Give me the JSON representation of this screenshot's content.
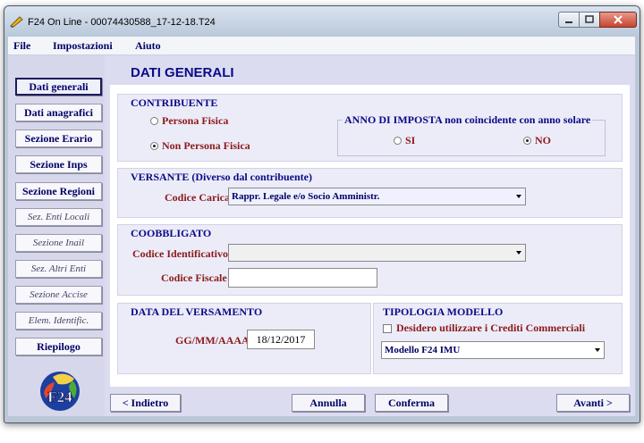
{
  "window": {
    "title": "F24 On Line - 00074430588_17-12-18.T24"
  },
  "menu": [
    "File",
    "Impostazioni",
    "Aiuto"
  ],
  "sidebar": {
    "items": [
      {
        "label": "Dati generali"
      },
      {
        "label": "Dati anagrafici"
      },
      {
        "label": "Sezione Erario"
      },
      {
        "label": "Sezione Inps"
      },
      {
        "label": "Sezione Regioni"
      },
      {
        "label": "Sez. Enti Locali"
      },
      {
        "label": "Sezione Inail"
      },
      {
        "label": "Sez. Altri Enti"
      },
      {
        "label": "Sezione Accise"
      },
      {
        "label": "Elem. Identific."
      },
      {
        "label": "Riepilogo"
      }
    ],
    "logo_text": "F24"
  },
  "page": {
    "title": "DATI GENERALI"
  },
  "contribuente": {
    "title": "CONTRIBUENTE",
    "persona_fisica": "Persona Fisica",
    "non_persona_fisica": "Non Persona Fisica",
    "anno_title": "ANNO DI IMPOSTA non coincidente con anno solare",
    "si": "SI",
    "no": "NO"
  },
  "versante": {
    "title": "VERSANTE (Diverso dal contribuente)",
    "codice_carica_label": "Codice Carica",
    "codice_carica_value": "Rappr. Legale e/o Socio Amministr."
  },
  "coobbligato": {
    "title": "COOBBLIGATO",
    "codice_identificativo_label": "Codice Identificativo",
    "codice_identificativo_value": "",
    "codice_fiscale_label": "Codice Fiscale",
    "codice_fiscale_value": ""
  },
  "versamento": {
    "title": "DATA DEL VERSAMENTO",
    "date_label": "GG/MM/AAAA",
    "date_value": "18/12/2017"
  },
  "tipologia": {
    "title": "TIPOLOGIA MODELLO",
    "crediti_label": "Desidero utilizzare i Crediti Commerciali",
    "modello_value": "Modello F24 IMU"
  },
  "footer": {
    "indietro": "< Indietro",
    "annulla": "Annulla",
    "conferma": "Conferma",
    "avanti": "Avanti >"
  }
}
